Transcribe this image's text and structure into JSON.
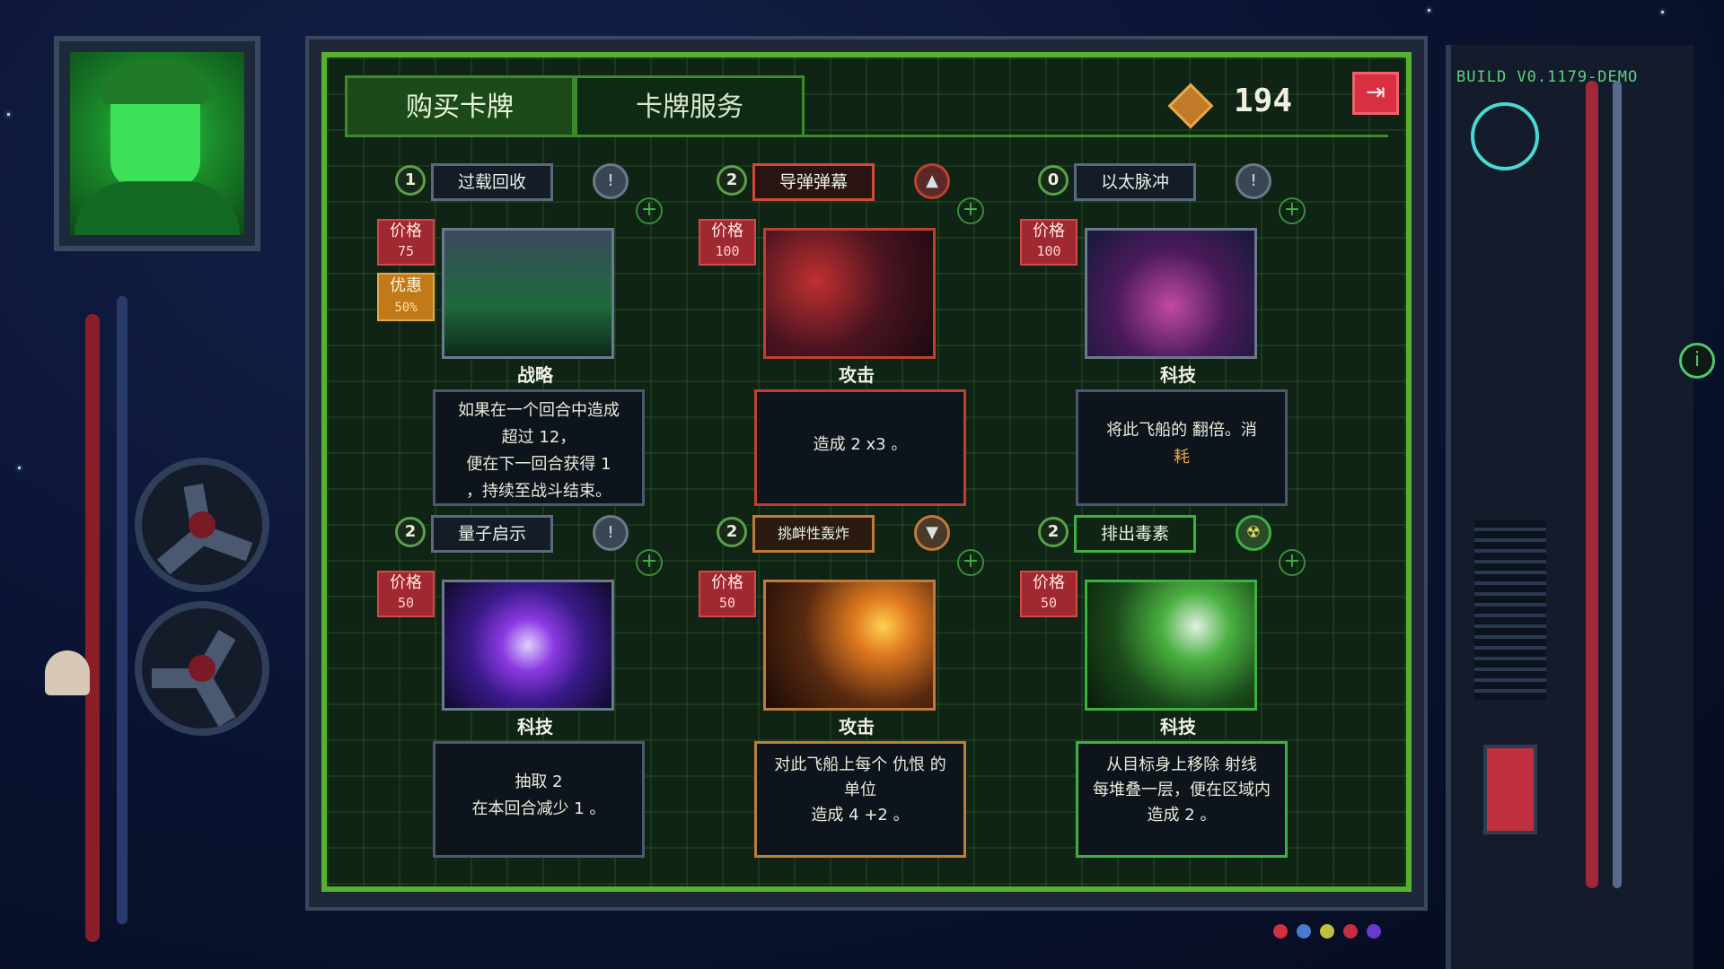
{
  "build": "BUILD V0.1179-DEMO",
  "tabs": [
    {
      "label": "购买卡牌",
      "active": true
    },
    {
      "label": "卡牌服务",
      "active": false
    }
  ],
  "credits": "194",
  "exit_icon": "exit-icon",
  "cards": [
    {
      "title": "过载回收",
      "cost": "1",
      "type": "战略",
      "color": "gray",
      "price_label": "价格",
      "price": "75",
      "discount_label": "优惠",
      "discount": "50%",
      "stat": "0",
      "desc": [
        "如果在一个回合中造成",
        "超过 12，",
        "便在下一回合获得 1",
        "，持续至战斗结束。"
      ]
    },
    {
      "title": "导弹弹幕",
      "cost": "2",
      "type": "攻击",
      "color": "red",
      "price_label": "价格",
      "price": "100",
      "stat": "2",
      "stat2": "5",
      "desc": [
        "造成 2 x3 。"
      ]
    },
    {
      "title": "以太脉冲",
      "cost": "0",
      "type": "科技",
      "color": "gray",
      "price_label": "价格",
      "price": "100",
      "stat": "0",
      "desc": [
        "将此飞船的 翻倍。消",
        "耗"
      ]
    },
    {
      "title": "量子启示",
      "cost": "2",
      "type": "科技",
      "color": "gray",
      "price_label": "价格",
      "price": "50",
      "stat": "0",
      "desc": [
        "抽取 2",
        "在本回合减少 1 。"
      ]
    },
    {
      "title": "挑衅性轰炸",
      "cost": "2",
      "type": "攻击",
      "color": "orange",
      "price_label": "价格",
      "price": "50",
      "stat": "2",
      "stat2": "3",
      "desc": [
        "对此飞船上每个 仇恨 的",
        "单位",
        "造成 4 +2 。"
      ]
    },
    {
      "title": "排出毒素",
      "cost": "2",
      "type": "科技",
      "color": "green",
      "price_label": "价格",
      "price": "50",
      "stat": "0",
      "desc": [
        "从目标身上移除 射线",
        "每堆叠一层，便在区域内",
        "造成 2 。"
      ]
    }
  ],
  "colors": {
    "frame_green": "#58b030",
    "attack_red": "#c04030",
    "attack_orange": "#c07a3a",
    "tech_green": "#3cb040",
    "price_red": "#a02830",
    "discount_orange": "#c07a1a"
  }
}
